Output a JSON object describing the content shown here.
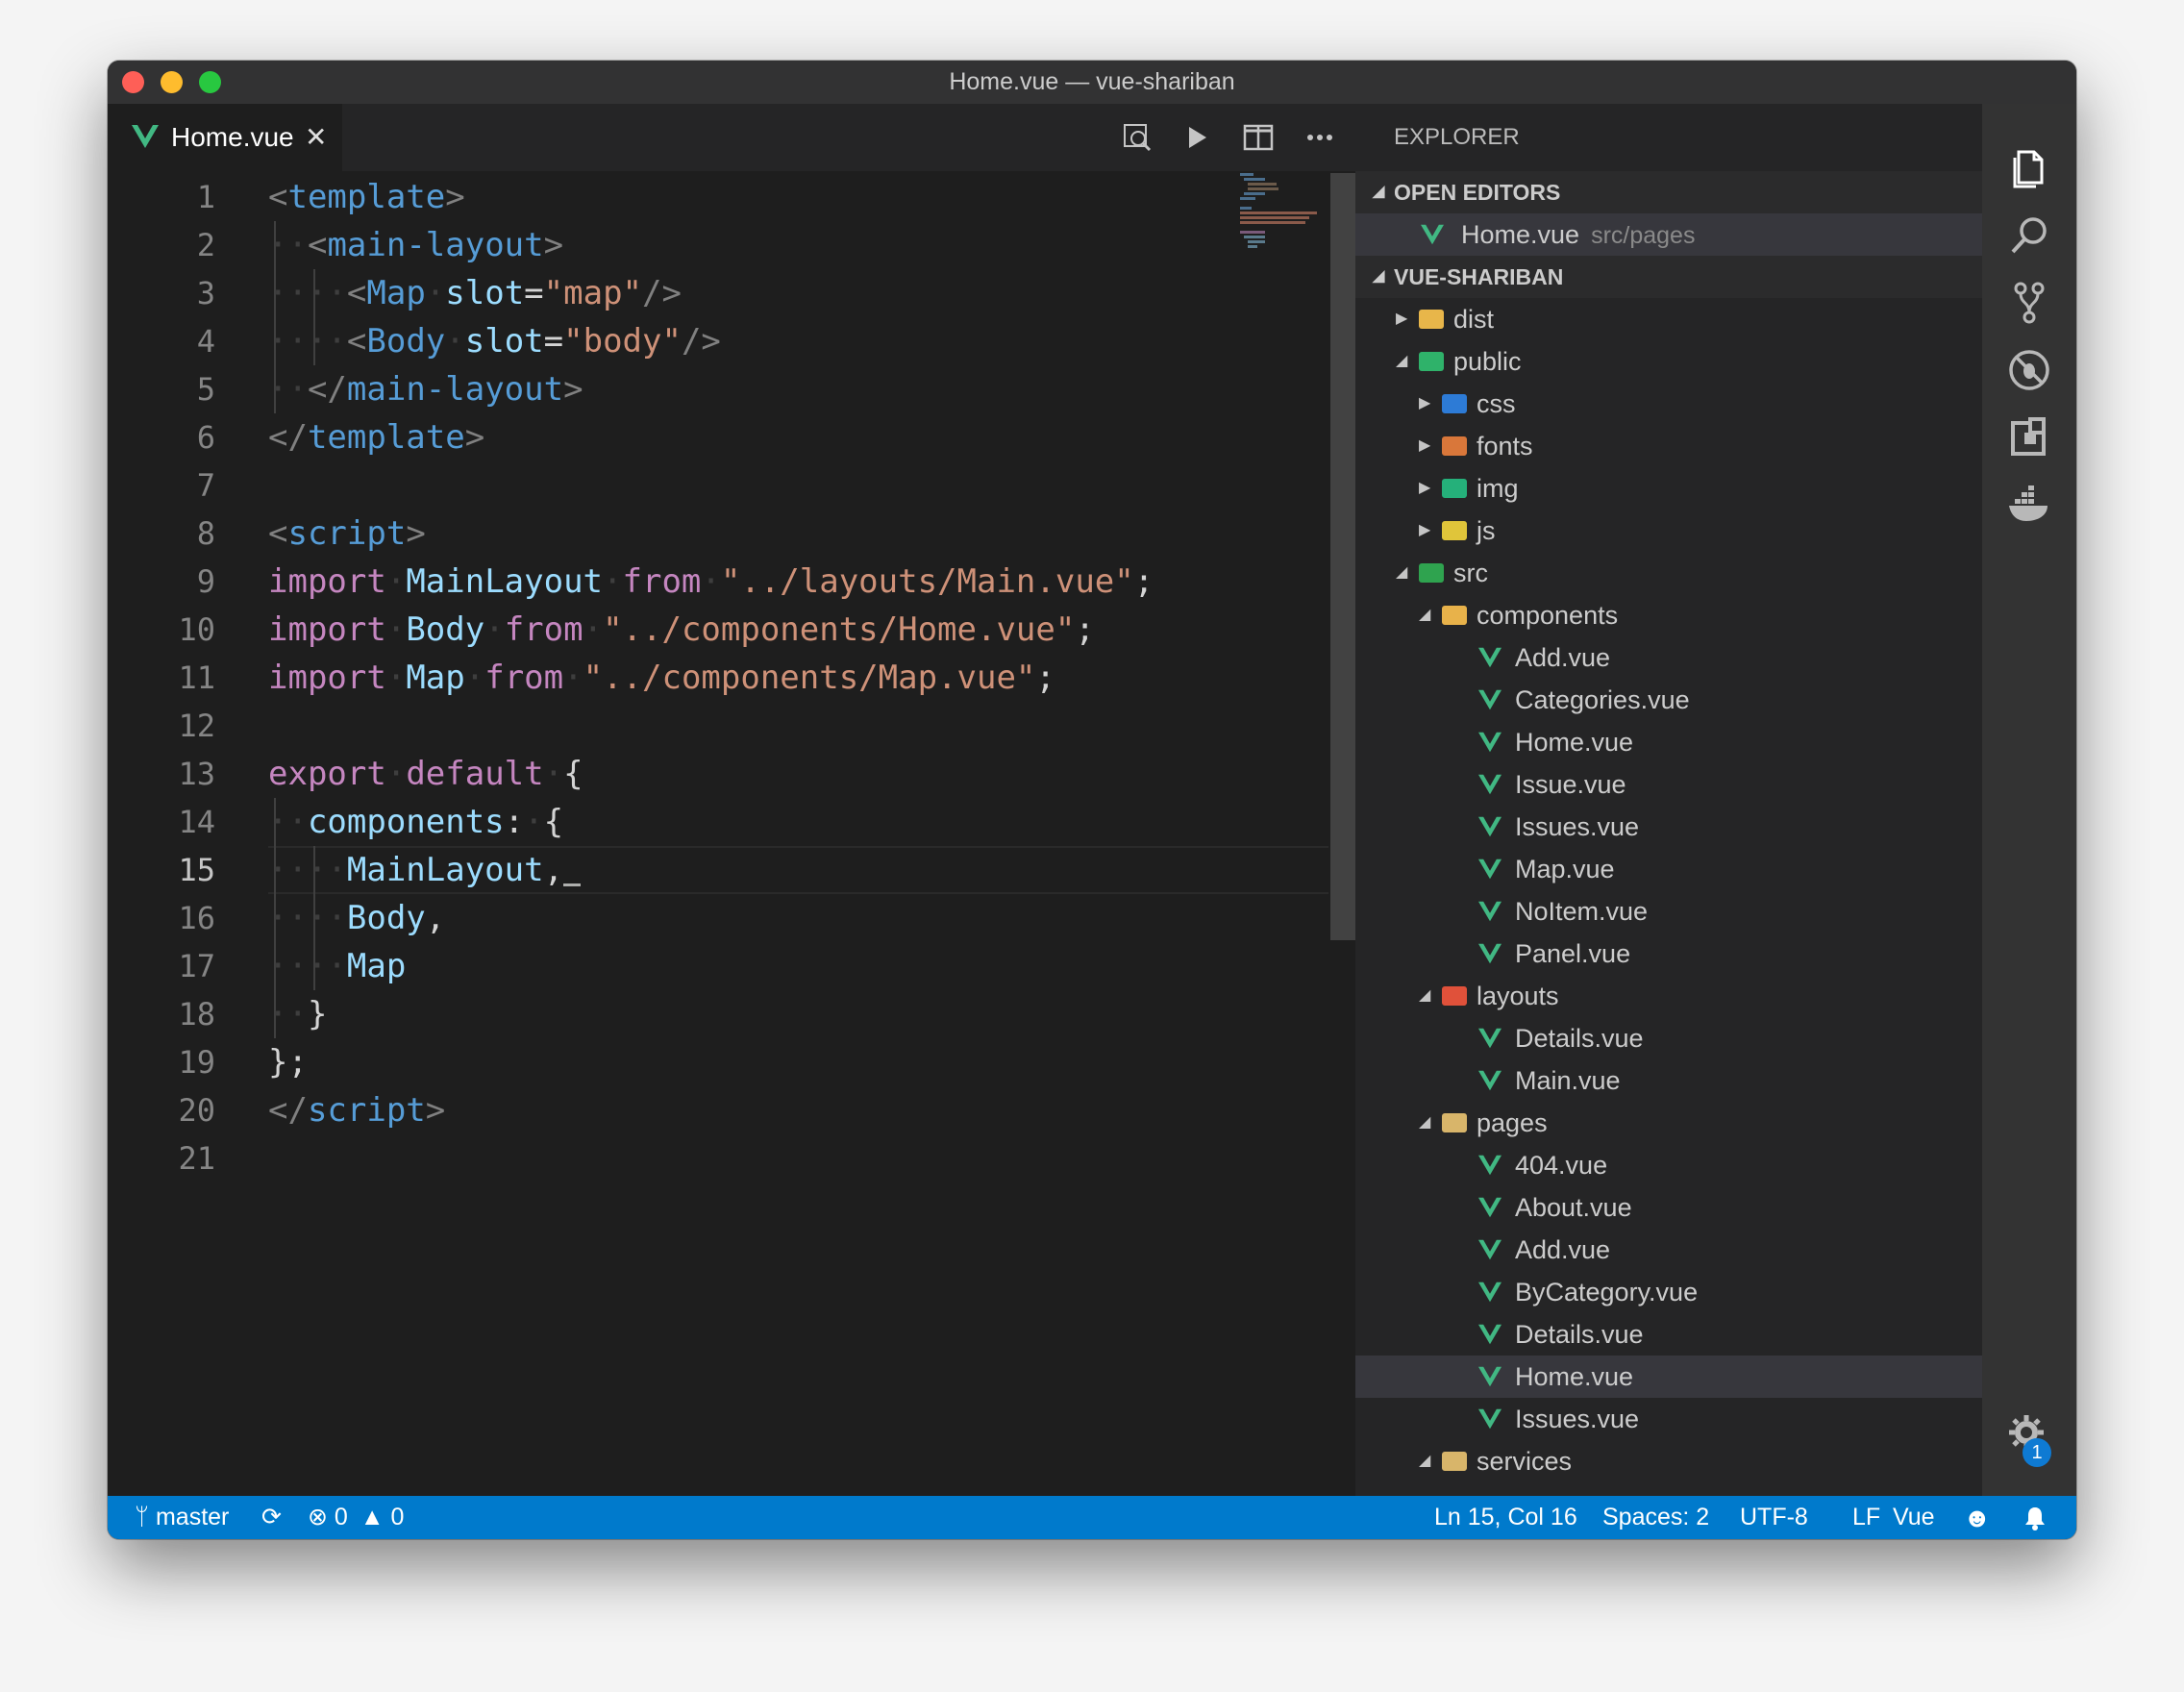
{
  "window": {
    "title": "Home.vue — vue-shariban"
  },
  "tab": {
    "label": "Home.vue",
    "close": "✕"
  },
  "editor": {
    "line_numbers": [
      "1",
      "2",
      "3",
      "4",
      "5",
      "6",
      "7",
      "8",
      "9",
      "10",
      "11",
      "12",
      "13",
      "14",
      "15",
      "16",
      "17",
      "18",
      "19",
      "20",
      "21"
    ],
    "active_line": "15"
  },
  "sidebar": {
    "title": "EXPLORER",
    "open_editors_header": "OPEN EDITORS",
    "open_editor": {
      "name": "Home.vue",
      "path": "src/pages"
    },
    "project_header": "VUE-SHARIBAN",
    "tree": [
      {
        "name": "dist",
        "kind": "folder",
        "depth": 1,
        "expanded": false,
        "color": "#e8b64a"
      },
      {
        "name": "public",
        "kind": "folder",
        "depth": 1,
        "expanded": true,
        "color": "#2fb26a"
      },
      {
        "name": "css",
        "kind": "folder",
        "depth": 2,
        "expanded": false,
        "color": "#2d7bd6"
      },
      {
        "name": "fonts",
        "kind": "folder",
        "depth": 2,
        "expanded": false,
        "color": "#d9773a"
      },
      {
        "name": "img",
        "kind": "folder",
        "depth": 2,
        "expanded": false,
        "color": "#25b07a"
      },
      {
        "name": "js",
        "kind": "folder",
        "depth": 2,
        "expanded": false,
        "color": "#e0c53a"
      },
      {
        "name": "src",
        "kind": "folder",
        "depth": 1,
        "expanded": true,
        "color": "#2fa34f"
      },
      {
        "name": "components",
        "kind": "folder",
        "depth": 2,
        "expanded": true,
        "color": "#e8b24a"
      },
      {
        "name": "Add.vue",
        "kind": "vue",
        "depth": 3
      },
      {
        "name": "Categories.vue",
        "kind": "vue",
        "depth": 3
      },
      {
        "name": "Home.vue",
        "kind": "vue",
        "depth": 3
      },
      {
        "name": "Issue.vue",
        "kind": "vue",
        "depth": 3
      },
      {
        "name": "Issues.vue",
        "kind": "vue",
        "depth": 3
      },
      {
        "name": "Map.vue",
        "kind": "vue",
        "depth": 3
      },
      {
        "name": "NoItem.vue",
        "kind": "vue",
        "depth": 3
      },
      {
        "name": "Panel.vue",
        "kind": "vue",
        "depth": 3
      },
      {
        "name": "layouts",
        "kind": "folder",
        "depth": 2,
        "expanded": true,
        "color": "#e0513a"
      },
      {
        "name": "Details.vue",
        "kind": "vue",
        "depth": 3
      },
      {
        "name": "Main.vue",
        "kind": "vue",
        "depth": 3
      },
      {
        "name": "pages",
        "kind": "folder",
        "depth": 2,
        "expanded": true,
        "color": "#d8b56a"
      },
      {
        "name": "404.vue",
        "kind": "vue",
        "depth": 3
      },
      {
        "name": "About.vue",
        "kind": "vue",
        "depth": 3
      },
      {
        "name": "Add.vue",
        "kind": "vue",
        "depth": 3
      },
      {
        "name": "ByCategory.vue",
        "kind": "vue",
        "depth": 3
      },
      {
        "name": "Details.vue",
        "kind": "vue",
        "depth": 3
      },
      {
        "name": "Home.vue",
        "kind": "vue",
        "depth": 3,
        "selected": true
      },
      {
        "name": "Issues.vue",
        "kind": "vue",
        "depth": 3
      },
      {
        "name": "services",
        "kind": "folder",
        "depth": 2,
        "expanded": true,
        "color": "#d8b56a"
      }
    ]
  },
  "code": {
    "l1_tag": "template",
    "l2_tag": "main-layout",
    "l3_tag": "Map",
    "l3_attr": "slot",
    "l3_val": "\"map\"",
    "l4_tag": "Body",
    "l4_attr": "slot",
    "l4_val": "\"body\"",
    "l5_tag": "main-layout",
    "l6_tag": "template",
    "l8_tag": "script",
    "l9_kw": "import",
    "l9_id": "MainLayout",
    "l9_from": "from",
    "l9_str": "\"../layouts/Main.vue\"",
    "l10_kw": "import",
    "l10_id": "Body",
    "l10_from": "from",
    "l10_str": "\"../components/Home.vue\"",
    "l11_kw": "import",
    "l11_id": "Map",
    "l11_from": "from",
    "l11_str": "\"../components/Map.vue\"",
    "l13_kw1": "export",
    "l13_kw2": "default",
    "l14_key": "components",
    "l15_id": "MainLayout",
    "l16_id": "Body",
    "l17_id": "Map",
    "l20_tag": "script"
  },
  "status": {
    "branch": "master",
    "errors": "0",
    "warnings": "0",
    "position": "Ln 15, Col 16",
    "spaces": "Spaces: 2",
    "encoding": "UTF-8",
    "eol": "LF",
    "language": "Vue"
  },
  "activity": {
    "settings_badge": "1"
  },
  "colors": {
    "accent": "#007acc",
    "vue_green": "#41b883",
    "editor_bg": "#1e1e1e",
    "sidebar_bg": "#252526"
  },
  "icons": [
    "files-icon",
    "search-icon",
    "source-control-icon",
    "debug-icon",
    "extensions-icon",
    "docker-icon",
    "gear-icon"
  ]
}
